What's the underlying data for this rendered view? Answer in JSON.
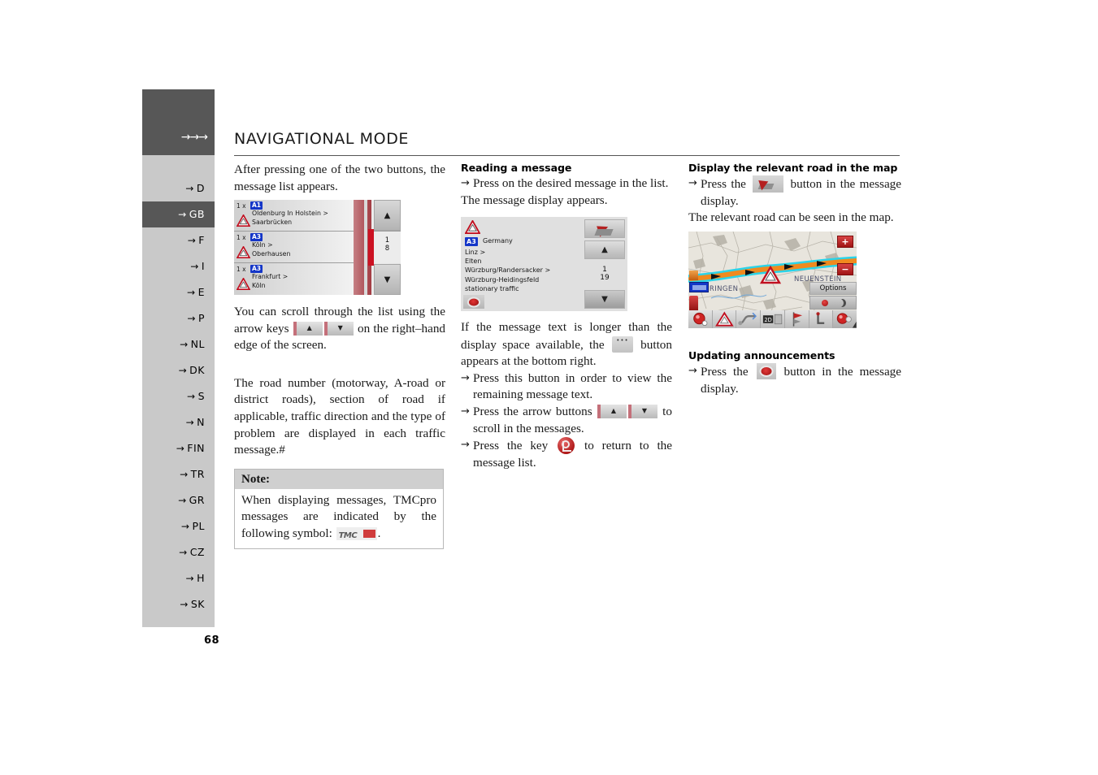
{
  "page": {
    "number": "68",
    "title": "NAVIGATIONAL MODE",
    "header_arrows": "→→→"
  },
  "sidebar": {
    "items": [
      {
        "label": "D",
        "active": false
      },
      {
        "label": "GB",
        "active": true
      },
      {
        "label": "F",
        "active": false
      },
      {
        "label": "I",
        "active": false
      },
      {
        "label": "E",
        "active": false
      },
      {
        "label": "P",
        "active": false
      },
      {
        "label": "NL",
        "active": false
      },
      {
        "label": "DK",
        "active": false
      },
      {
        "label": "S",
        "active": false
      },
      {
        "label": "N",
        "active": false
      },
      {
        "label": "FIN",
        "active": false
      },
      {
        "label": "TR",
        "active": false
      },
      {
        "label": "GR",
        "active": false
      },
      {
        "label": "PL",
        "active": false
      },
      {
        "label": "CZ",
        "active": false
      },
      {
        "label": "H",
        "active": false
      },
      {
        "label": "SK",
        "active": false
      }
    ]
  },
  "column1": {
    "intro": "After pressing one of the two buttons, the message list appears.",
    "scroll_text_before": "You can scroll through the list using the arrow keys",
    "scroll_text_after": "on the right–hand edge of the screen.",
    "road_paragraph": "The road number (motorway, A-road or district roads), section of road if applicable, traffic direction and the type of problem are displayed in each traffic message.#",
    "note": {
      "heading": "Note:",
      "text_before": "When displaying messages, TMCpro messages are indicated by the following symbol:",
      "logo_text": "TMC",
      "text_after": "."
    }
  },
  "column2": {
    "heading": "Reading a message",
    "bullet1": "Press on the desired message in the list.",
    "after_bullet1": "The message display appears.",
    "longer_text_before": "If the message text is longer than the display space available, the",
    "longer_text_after": "button appears at the bottom right.",
    "bullet2": "Press this button in order to view the remaining message text.",
    "bullet3_before": "Press the arrow buttons",
    "bullet3_after": "to scroll in the messages.",
    "bullet4_before": "Press the key",
    "bullet4_after": "to return to the message list."
  },
  "column3": {
    "heading": "Display the relevant road in the map",
    "bullet1_before": "Press the",
    "bullet1_after": "button in the message display.",
    "after_bullet1": "The relevant road can be seen in the map.",
    "heading2": "Updating announcements",
    "bullet2_before": "Press the",
    "bullet2_after": "button in the message display."
  },
  "screenshot_message_list": {
    "rows": [
      {
        "count": "1 x",
        "badge": "A1",
        "line1": "Oldenburg In Holstein >",
        "line2": "Saarbrücken"
      },
      {
        "count": "1 x",
        "badge": "A3",
        "line1": "Köln >",
        "line2": "Oberhausen"
      },
      {
        "count": "1 x",
        "badge": "A3",
        "line1": "Frankfurt >",
        "line2": "Köln"
      }
    ],
    "up_arrow": "▲",
    "down_arrow": "▼",
    "page_num": "1",
    "page_den": "8"
  },
  "screenshot_message_display": {
    "badge": "A3",
    "country": "Germany",
    "lines": [
      "Linz >",
      "Elten",
      "Würzburg/Randersacker >",
      "Würzburg-Heidingsfeld",
      "stationary traffic"
    ],
    "up_arrow": "▲",
    "down_arrow": "▼",
    "page_num": "1",
    "page_den": "19"
  },
  "screenshot_map": {
    "labels": {
      "city_left": "ÖHRINGEN",
      "city_right": "NEUENSTEIN"
    },
    "zoom_in": "+",
    "zoom_out": "−",
    "options": "Options",
    "colors": {
      "route_core": "#f08a1e",
      "route_halo": "#2ad3e8",
      "map_bg": "#e8e5dd",
      "badge_blue": "#1436c8",
      "accent_red": "#cc1122"
    }
  },
  "colors": {
    "sidebar_bg": "#c9c9c9",
    "sidebar_active": "#575757",
    "text": "#1a1a1a",
    "rule": "#555555"
  }
}
